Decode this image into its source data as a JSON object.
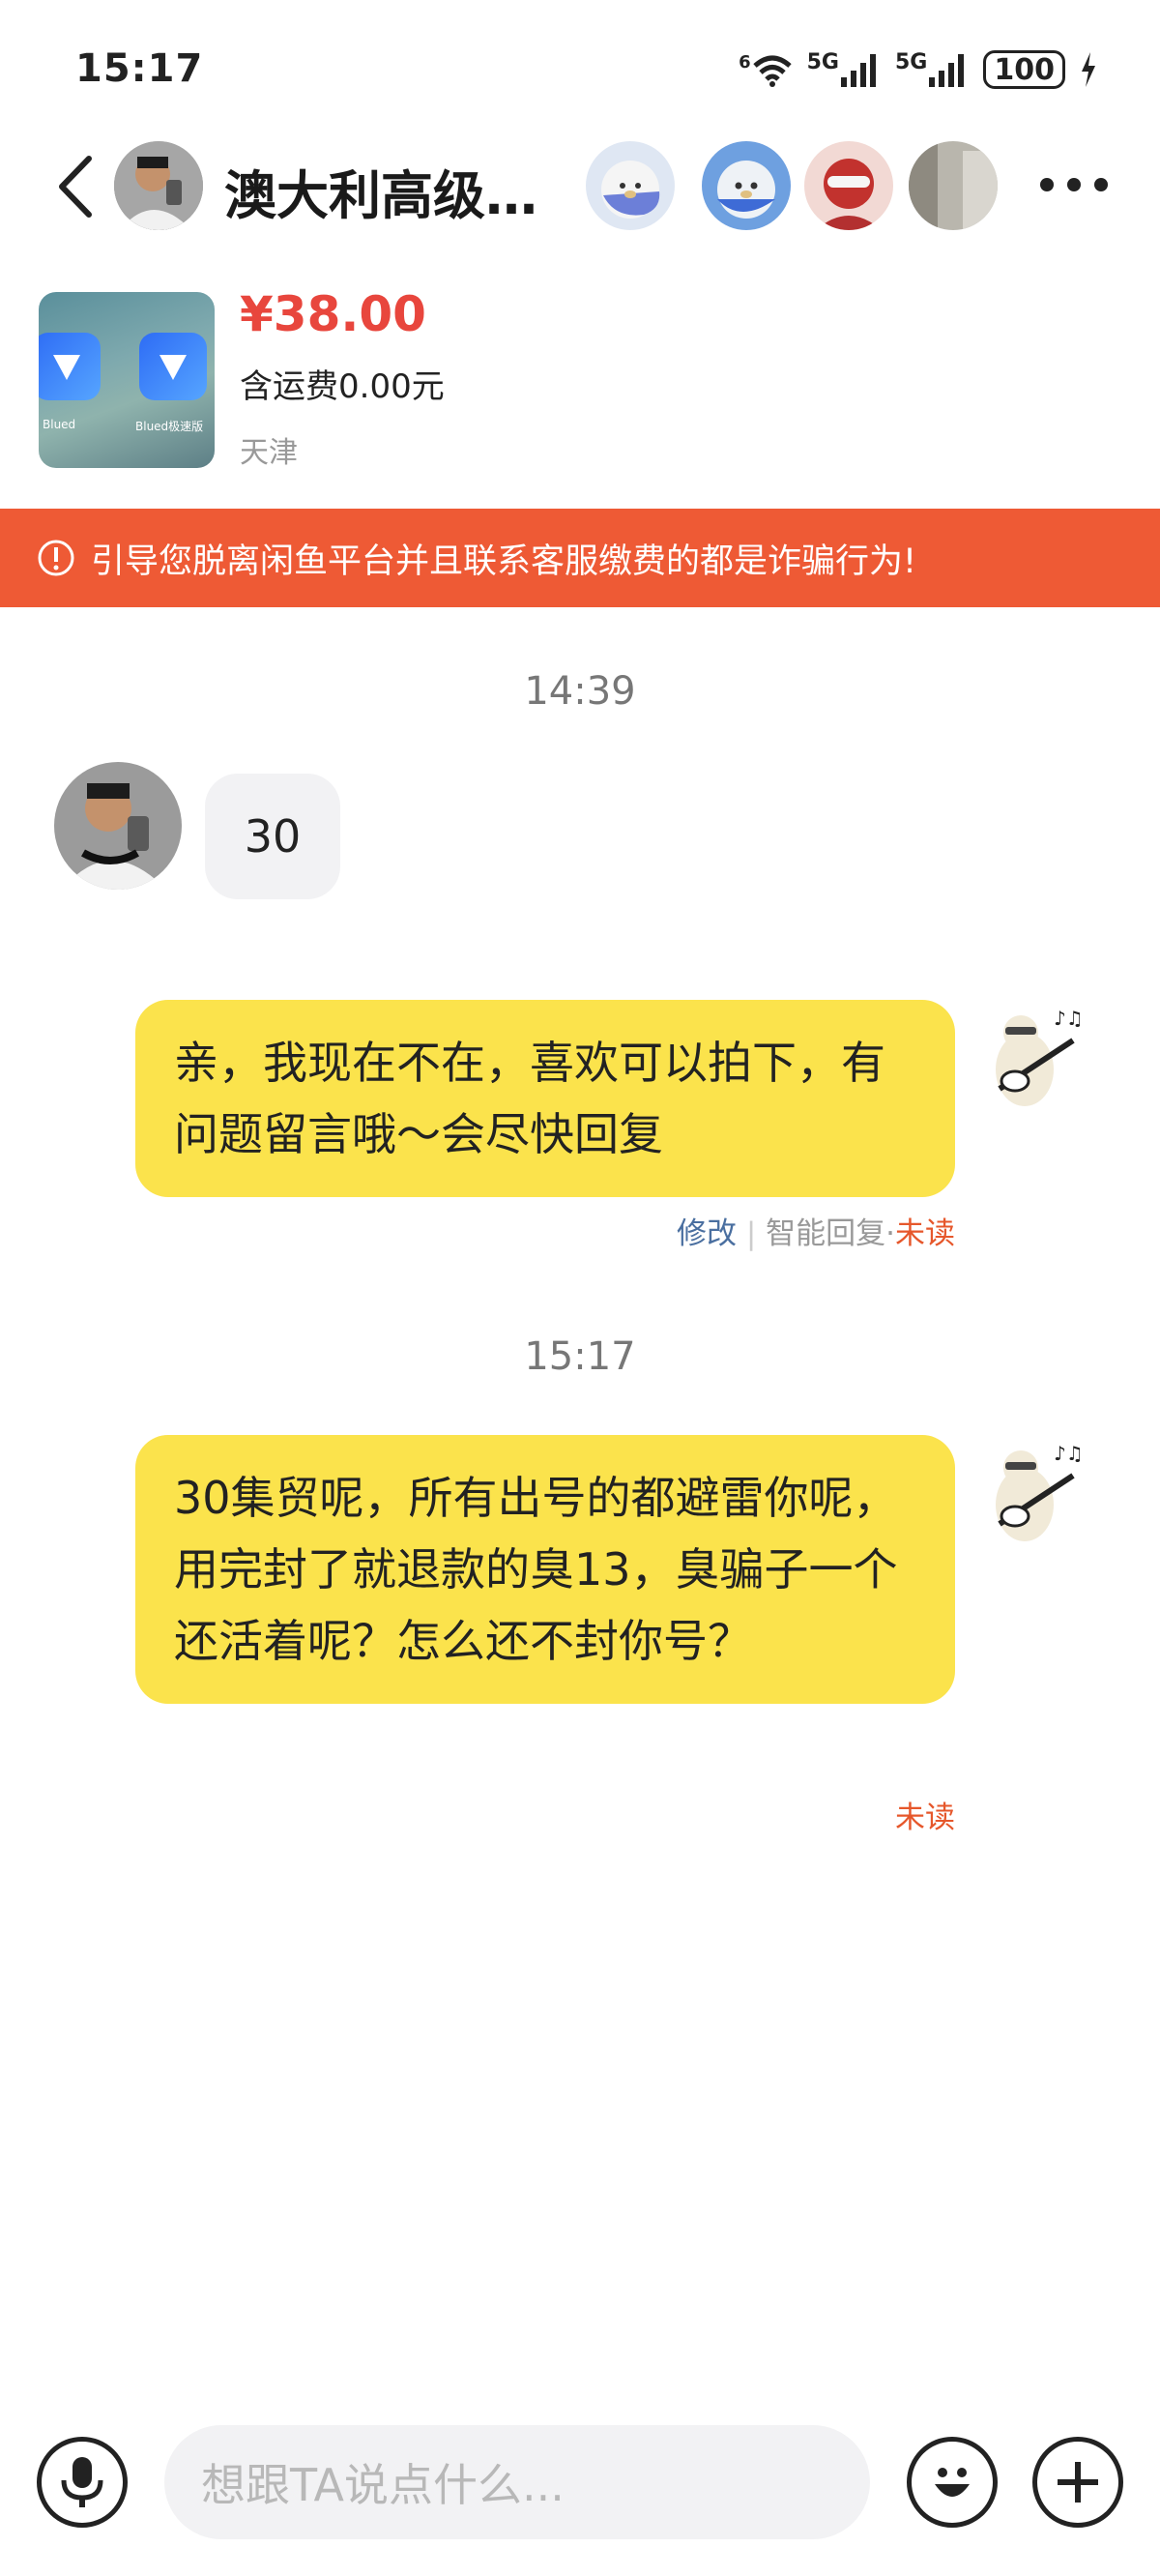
{
  "status_bar": {
    "time": "15:17",
    "net1": "6",
    "net2": "5G",
    "net3": "5G",
    "battery": "100"
  },
  "header": {
    "title": "澳大利高级…",
    "back_icon": "chevron-left-icon",
    "more_icon": "more-dots-icon"
  },
  "product": {
    "price": "¥38.00",
    "shipping": "含运费0.00元",
    "location": "天津",
    "app1_caption": "Blued",
    "app2_caption": "Blued极速版"
  },
  "warning": {
    "text": "引导您脱离闲鱼平台并且联系客服缴费的都是诈骗行为!"
  },
  "messages": [
    {
      "type": "timestamp",
      "text": "14:39"
    },
    {
      "type": "incoming",
      "text": "30"
    },
    {
      "type": "outgoing",
      "text": "亲，我现在不在，喜欢可以拍下，有问题留言哦～会尽快回复",
      "meta_edit": "修改",
      "meta_sep": "|",
      "meta_smart": "智能回复",
      "meta_dot": "·",
      "meta_status": "未读"
    },
    {
      "type": "timestamp",
      "text": "15:17"
    },
    {
      "type": "outgoing",
      "text": "30集贸呢，所有出号的都避雷你呢，用完封了就退款的臭13，臭骗子一个还活着呢？怎么还不封你号？",
      "meta_status": "未读"
    }
  ],
  "input_bar": {
    "placeholder": "想跟TA说点什么...",
    "voice_icon": "microphone-icon",
    "emoji_icon": "emoji-icon",
    "plus_icon": "plus-icon"
  },
  "colors": {
    "accent_red": "#e8463d",
    "banner": "#ee5a35",
    "bubble_yellow": "#fbe34c",
    "unread": "#e6572b",
    "edit_link": "#4a6fa0"
  }
}
